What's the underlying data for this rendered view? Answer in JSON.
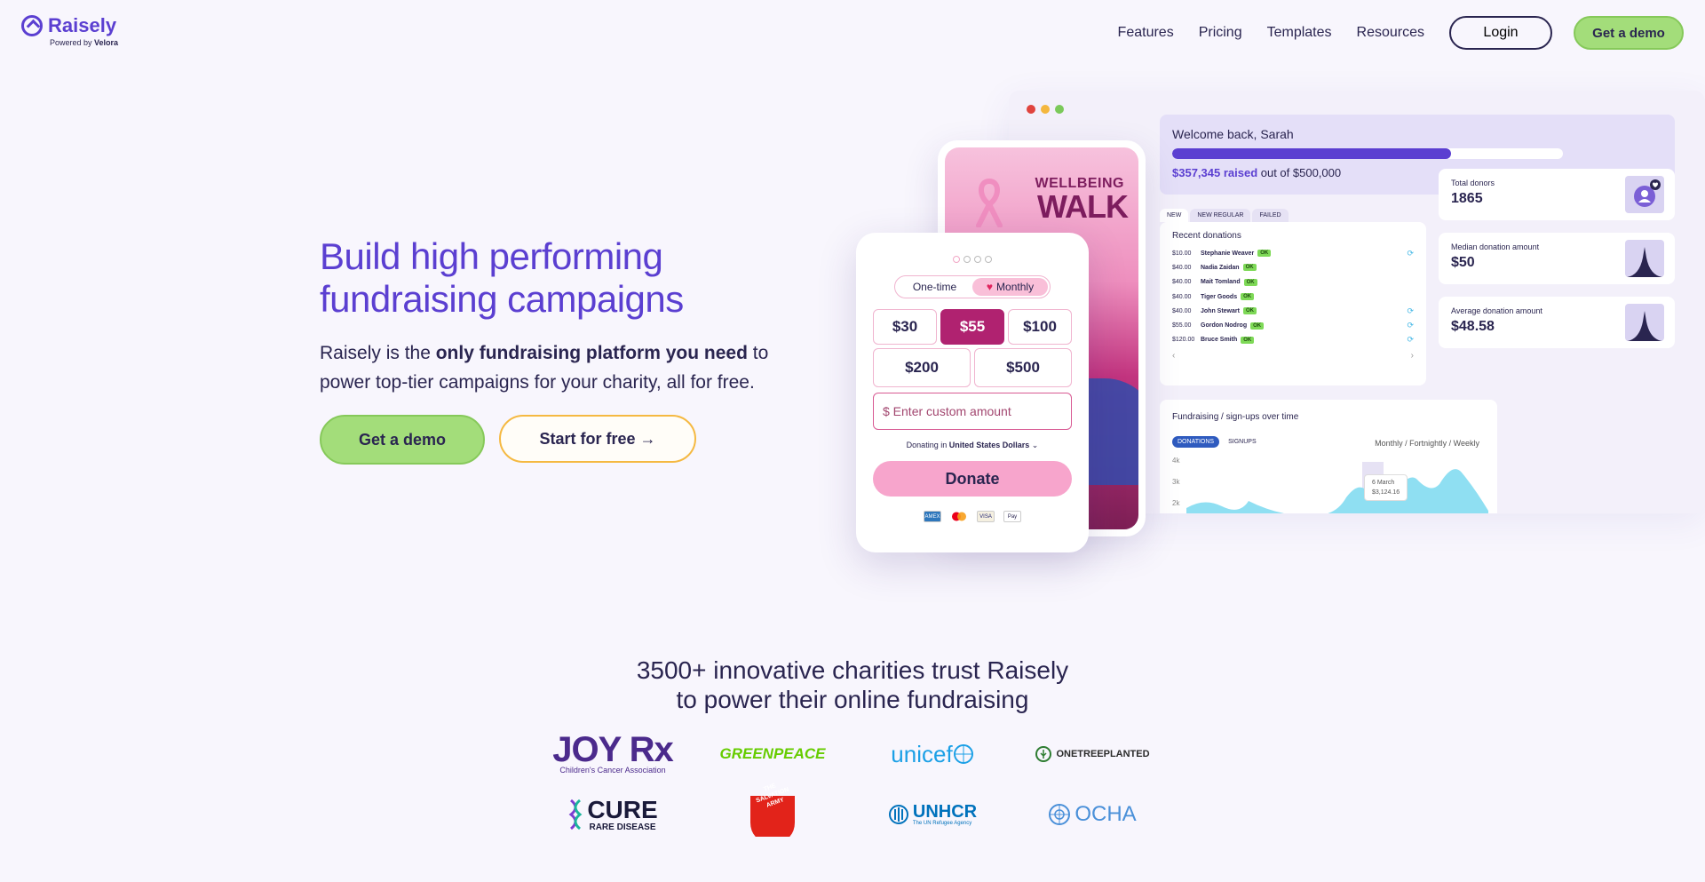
{
  "brand": {
    "name": "Raisely",
    "powered_prefix": "Powered by",
    "powered_by": "Velora",
    "color": "#5b3fd1"
  },
  "nav": {
    "links": [
      "Features",
      "Pricing",
      "Templates",
      "Resources"
    ],
    "login": "Login",
    "demo": "Get a demo"
  },
  "hero": {
    "title": "Build high performing fundraising campaigns",
    "desc_pre": "Raisely is the ",
    "desc_bold": "only fundraising platform you need",
    "desc_post": " to power top-tier campaigns for your charity, all for free.",
    "cta_demo": "Get a demo",
    "cta_free": "Start for free →"
  },
  "dashboard": {
    "welcome": "Welcome back, Sarah",
    "raised_amount": "$357,345 raised",
    "raised_suffix": " out of $500,000",
    "progress_fraction": 0.714,
    "tabs": [
      "NEW",
      "NEW REGULAR",
      "FAILED"
    ],
    "recent_title": "Recent donations",
    "donations": [
      {
        "amount": "$10.00",
        "name": "Stephanie Weaver",
        "status": "OK",
        "recurring": true
      },
      {
        "amount": "$40.00",
        "name": "Nadia Zaidan",
        "status": "OK",
        "recurring": false
      },
      {
        "amount": "$40.00",
        "name": "Mait Tomland",
        "status": "OK",
        "recurring": false
      },
      {
        "amount": "$40.00",
        "name": "Tiger Goods",
        "status": "OK",
        "recurring": false
      },
      {
        "amount": "$40.00",
        "name": "John Stewart",
        "status": "OK",
        "recurring": true
      },
      {
        "amount": "$55.00",
        "name": "Gordon Nodrog",
        "status": "OK",
        "recurring": true
      },
      {
        "amount": "$120.00",
        "name": "Bruce Smith",
        "status": "OK",
        "recurring": true
      }
    ],
    "stats": [
      {
        "label": "Total donors",
        "value": "1865"
      },
      {
        "label": "Median donation amount",
        "value": "$50"
      },
      {
        "label": "Average donation amount",
        "value": "$48.58"
      }
    ],
    "chart_title": "Fundraising / sign-ups over time",
    "chart_tabs": [
      "DONATIONS",
      "SIGNUPS"
    ],
    "chart_freq": "Monthly  /  Fortnightly  /  Weekly",
    "chart_yticks": [
      "4k",
      "3k",
      "2k"
    ],
    "tooltip_date": "6 March",
    "tooltip_value": "$3,124.16"
  },
  "campaign": {
    "title_small": "WELLBEING",
    "title_big": "WALK"
  },
  "donation_form": {
    "toggle": [
      "One-time",
      "Monthly"
    ],
    "amounts_row1": [
      "$30",
      "$55",
      "$100"
    ],
    "amounts_row2": [
      "$200",
      "$500"
    ],
    "selected": "$55",
    "custom_placeholder": "$ Enter custom amount",
    "currency_pre": "Donating in ",
    "currency": "United States Dollars",
    "donate": "Donate",
    "cards": [
      "AMEX",
      "MC",
      "VISA",
      "Pay"
    ]
  },
  "trust": {
    "line1": "3500+ innovative charities trust Raisely",
    "line2": "to power their online fundraising"
  },
  "logos": [
    {
      "name": "JOY Rx",
      "sub": "Children's Cancer Association",
      "color": "#4b2a8c"
    },
    {
      "name": "GREENPEACE",
      "color": "#66cc00"
    },
    {
      "name": "unicef",
      "color": "#1ca0e6"
    },
    {
      "name": "ONETREEPLANTED",
      "color": "#2b2b2b"
    },
    {
      "name": "CURE",
      "sub": "RARE DISEASE",
      "color": "#1a1a3a"
    },
    {
      "name": "THE SALVATION ARMY",
      "color": "#e2231a"
    },
    {
      "name": "UNHCR",
      "sub": "The UN Refugee Agency",
      "color": "#0072bc"
    },
    {
      "name": "OCHA",
      "color": "#4a90d9"
    }
  ]
}
